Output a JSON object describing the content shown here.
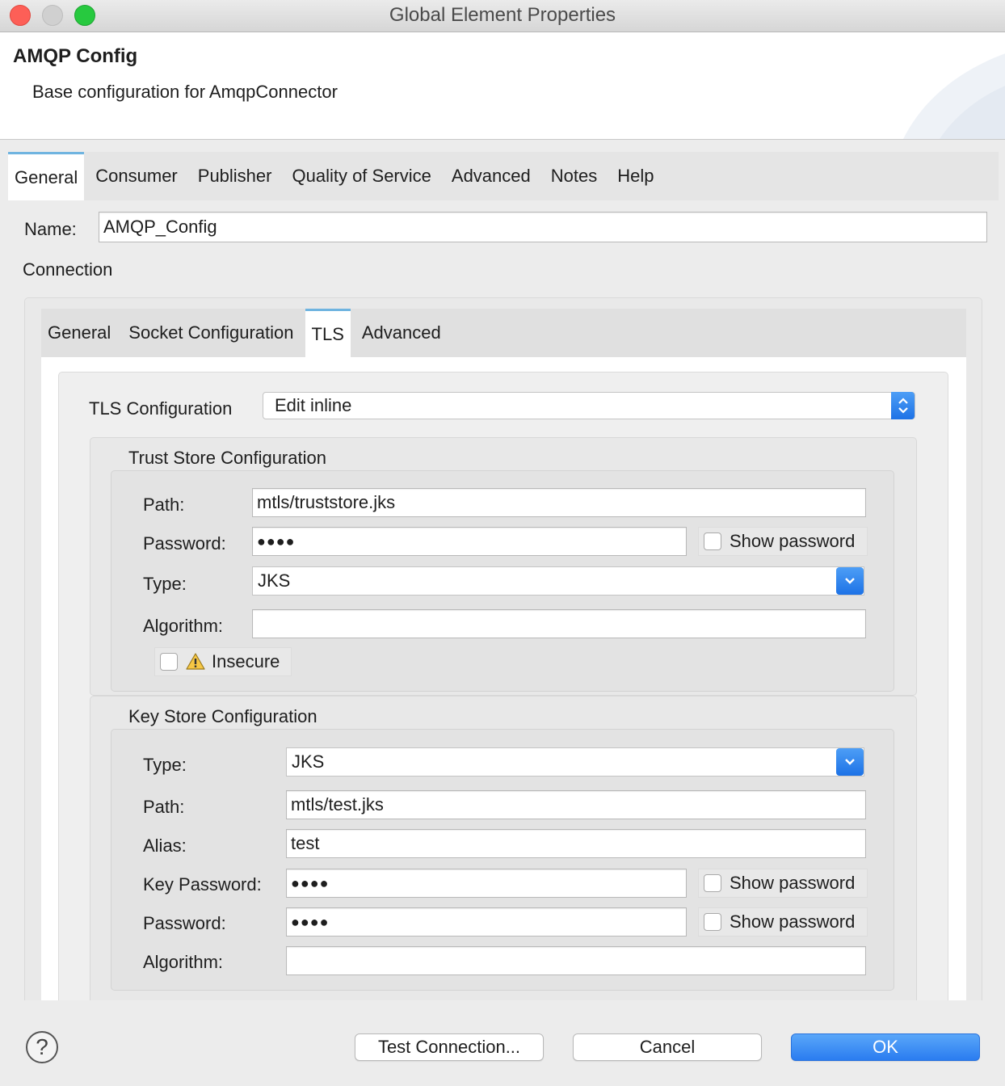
{
  "window": {
    "title": "Global Element Properties",
    "traffic_lights": {
      "close": "#fd5f57",
      "minimize": "#d0d0d0",
      "zoom": "#27c93f"
    }
  },
  "header": {
    "title": "AMQP Config",
    "description": "Base configuration for AmqpConnector"
  },
  "outer_tabs": [
    "General",
    "Consumer",
    "Publisher",
    "Quality of Service",
    "Advanced",
    "Notes",
    "Help"
  ],
  "general": {
    "name_label": "Name:",
    "name_value": "AMQP_Config",
    "connection_label": "Connection"
  },
  "inner_tabs": [
    "General",
    "Socket Configuration",
    "TLS",
    "Advanced"
  ],
  "tls": {
    "config_label": "TLS Configuration",
    "config_value": "Edit inline",
    "trust_store": {
      "title": "Trust Store Configuration",
      "path_label": "Path:",
      "path_value": "mtls/truststore.jks",
      "password_label": "Password:",
      "password_value": "●●●●",
      "show_password": "Show password",
      "type_label": "Type:",
      "type_value": "JKS",
      "algorithm_label": "Algorithm:",
      "algorithm_value": "",
      "insecure_label": "Insecure"
    },
    "key_store": {
      "title": "Key Store Configuration",
      "type_label": "Type:",
      "type_value": "JKS",
      "path_label": "Path:",
      "path_value": "mtls/test.jks",
      "alias_label": "Alias:",
      "alias_value": "test",
      "key_password_label": "Key Password:",
      "key_password_value": "●●●●",
      "password_label": "Password:",
      "password_value": "●●●●",
      "show_password": "Show password",
      "algorithm_label": "Algorithm:",
      "algorithm_value": ""
    }
  },
  "footer": {
    "help": "?",
    "test_connection": "Test Connection...",
    "cancel": "Cancel",
    "ok": "OK"
  },
  "icons": {
    "warning": "warning-icon",
    "stepper": "chevron-updown-icon",
    "dropdown": "chevron-down-icon"
  },
  "colors": {
    "accent": "#2a7cf0",
    "active_tab_border": "#6fb4e0"
  }
}
